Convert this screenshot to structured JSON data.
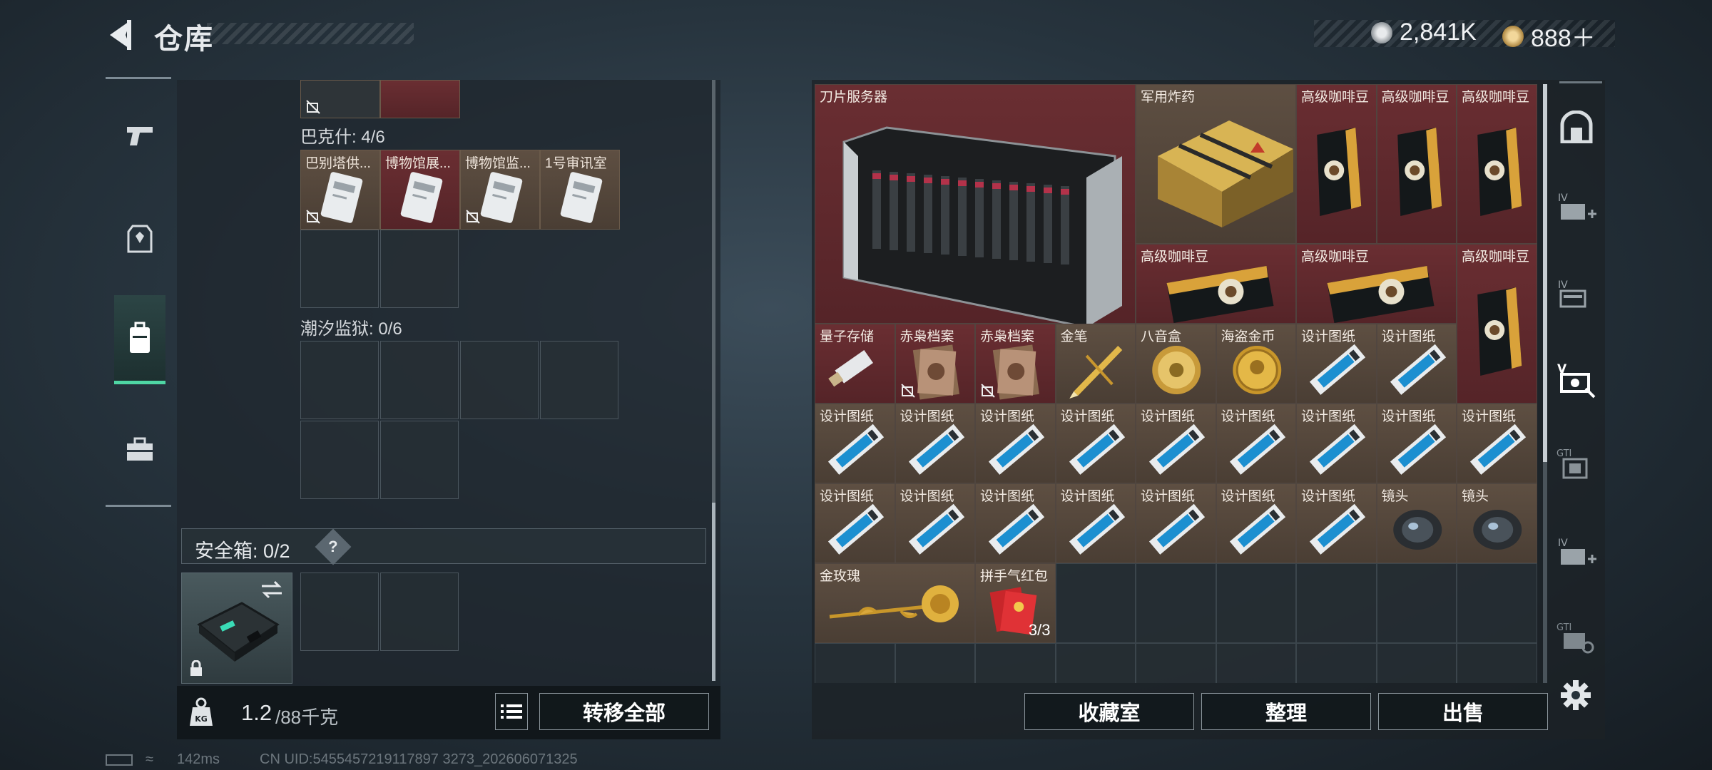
{
  "header": {
    "title": "仓库",
    "currency_silver": "2,841K",
    "currency_gold": "888＋"
  },
  "left_nav": {
    "items": [
      {
        "icon": "pistol-icon"
      },
      {
        "icon": "armor-vest-icon"
      },
      {
        "icon": "backpack-icon",
        "active": true
      },
      {
        "icon": "toolbox-icon"
      }
    ]
  },
  "left_panel": {
    "bakesh_label": "巴克什: 4/6",
    "bakesh_items": [
      {
        "name": "巴别塔供...",
        "bg": "brown",
        "nobind": true
      },
      {
        "name": "博物馆展...",
        "bg": "red",
        "nobind": false
      },
      {
        "name": "博物馆监...",
        "bg": "brown",
        "nobind": true
      },
      {
        "name": "1号审讯室",
        "bg": "brown",
        "nobind": false
      }
    ],
    "tide_label": "潮汐监狱: 0/6",
    "safe_box_label": "安全箱: 0/2",
    "safe_box_help": "?",
    "weight_value": "1.2",
    "weight_max": "/88千克",
    "transfer_all_label": "转移全部"
  },
  "stash": {
    "items": [
      {
        "name": "刀片服务器",
        "bg": "red",
        "kind": "server"
      },
      {
        "name": "军用炸药",
        "bg": "brown",
        "kind": "crate"
      },
      {
        "name": "高级咖啡豆",
        "bg": "red",
        "kind": "coffee"
      },
      {
        "name": "高级咖啡豆",
        "bg": "red",
        "kind": "coffee"
      },
      {
        "name": "高级咖啡豆",
        "bg": "red",
        "kind": "coffee"
      },
      {
        "name": "高级咖啡豆",
        "bg": "red",
        "kind": "coffee-h"
      },
      {
        "name": "高级咖啡豆",
        "bg": "red",
        "kind": "coffee-h"
      },
      {
        "name": "高级咖啡豆",
        "bg": "red",
        "kind": "coffee"
      },
      {
        "name": "量子存储",
        "bg": "red",
        "kind": "usb"
      },
      {
        "name": "赤枭档案",
        "bg": "red",
        "kind": "file",
        "nobind": true
      },
      {
        "name": "赤枭档案",
        "bg": "red",
        "kind": "file",
        "nobind": true
      },
      {
        "name": "金笔",
        "bg": "brown",
        "kind": "pen"
      },
      {
        "name": "八音盒",
        "bg": "brown",
        "kind": "musicbox"
      },
      {
        "name": "海盗金币",
        "bg": "brown",
        "kind": "coin"
      },
      {
        "name": "设计图纸",
        "bg": "brown",
        "kind": "blueprint"
      },
      {
        "name": "设计图纸",
        "bg": "brown",
        "kind": "blueprint"
      },
      {
        "name": "设计图纸",
        "bg": "brown",
        "kind": "blueprint"
      },
      {
        "name": "设计图纸",
        "bg": "brown",
        "kind": "blueprint"
      },
      {
        "name": "设计图纸",
        "bg": "brown",
        "kind": "blueprint"
      },
      {
        "name": "设计图纸",
        "bg": "brown",
        "kind": "blueprint"
      },
      {
        "name": "设计图纸",
        "bg": "brown",
        "kind": "blueprint"
      },
      {
        "name": "设计图纸",
        "bg": "brown",
        "kind": "blueprint"
      },
      {
        "name": "设计图纸",
        "bg": "brown",
        "kind": "blueprint"
      },
      {
        "name": "设计图纸",
        "bg": "brown",
        "kind": "blueprint"
      },
      {
        "name": "设计图纸",
        "bg": "brown",
        "kind": "blueprint"
      },
      {
        "name": "设计图纸",
        "bg": "brown",
        "kind": "blueprint"
      },
      {
        "name": "设计图纸",
        "bg": "brown",
        "kind": "blueprint"
      },
      {
        "name": "设计图纸",
        "bg": "brown",
        "kind": "blueprint"
      },
      {
        "name": "设计图纸",
        "bg": "brown",
        "kind": "blueprint"
      },
      {
        "name": "设计图纸",
        "bg": "brown",
        "kind": "blueprint"
      },
      {
        "name": "设计图纸",
        "bg": "brown",
        "kind": "blueprint"
      },
      {
        "name": "设计图纸",
        "bg": "brown",
        "kind": "blueprint"
      },
      {
        "name": "镜头",
        "bg": "brown",
        "kind": "lens"
      },
      {
        "name": "镜头",
        "bg": "brown",
        "kind": "lens"
      },
      {
        "name": "金玫瑰",
        "bg": "brown",
        "kind": "rose"
      },
      {
        "name": "拼手气红包",
        "bg": "brown",
        "kind": "redpacket",
        "count": "3/3"
      }
    ],
    "collection_label": "收藏室",
    "sort_label": "整理",
    "sell_label": "出售"
  },
  "right_nav": {
    "items": [
      "backpack-tab-icon",
      "case-iv-add-icon",
      "case-iv-icon",
      "case-v-active-icon",
      "case-gti-icon",
      "case-iv-add-2-icon",
      "case-gti-2-icon"
    ]
  },
  "footer": {
    "ping": "142ms",
    "uid": "CN UID:5455457219117897 3273_202606071325"
  }
}
